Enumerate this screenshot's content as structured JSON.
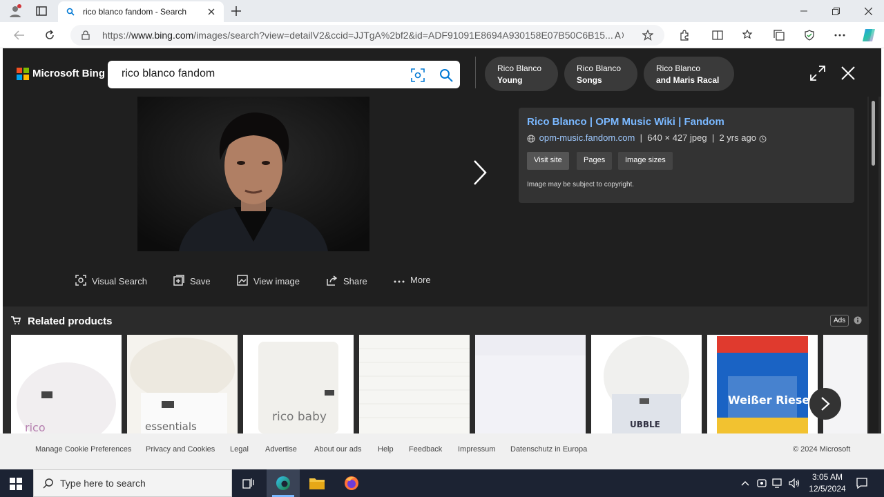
{
  "browser": {
    "tab_title": "rico blanco fandom - Search",
    "url_prefix": "https://",
    "url_host": "www.bing.com",
    "url_rest": "/images/search?view=detailV2&ccid=JJTgA%2bf2&id=ADF91091E8694A930158E07B50C6B15..."
  },
  "bing": {
    "logo": "Microsoft Bing",
    "search_value": "rico blanco fandom",
    "chips": [
      {
        "line1": "Rico Blanco",
        "line2": "Young"
      },
      {
        "line1": "Rico Blanco",
        "line2": "Songs"
      },
      {
        "line1": "Rico Blanco",
        "line2": "and Maris Racal"
      }
    ],
    "info": {
      "title": "Rico Blanco | OPM Music Wiki | Fandom",
      "domain": "opm-music.fandom.com",
      "size": "640 × 427 jpeg",
      "age": "2 yrs ago",
      "buttons": [
        "Visit site",
        "Pages",
        "Image sizes"
      ],
      "copyright": "Image may be subject to copyright."
    },
    "actions": [
      "Visual Search",
      "Save",
      "View image",
      "Share",
      "More"
    ],
    "related_title": "Related products",
    "ads_label": "Ads",
    "products": [
      {
        "text": "rico"
      },
      {
        "text": "essentials"
      },
      {
        "text": "rico baby"
      },
      {
        "text": ""
      },
      {
        "text": ""
      },
      {
        "text": "UBBLE"
      },
      {
        "text": "Weißer Riese"
      },
      {
        "text": ""
      }
    ]
  },
  "footer": {
    "links": [
      "Manage Cookie Preferences",
      "Privacy and Cookies",
      "Legal",
      "Advertise",
      "About our ads",
      "Help",
      "Feedback",
      "Impressum",
      "Datenschutz in Europa"
    ],
    "copyright": "© 2024 Microsoft"
  },
  "taskbar": {
    "search_placeholder": "Type here to search",
    "time": "3:05 AM",
    "date": "12/5/2024"
  },
  "colors": {
    "accent": "#0078d4",
    "link": "#7ab8ff",
    "overlay": "#2b2b2b"
  }
}
